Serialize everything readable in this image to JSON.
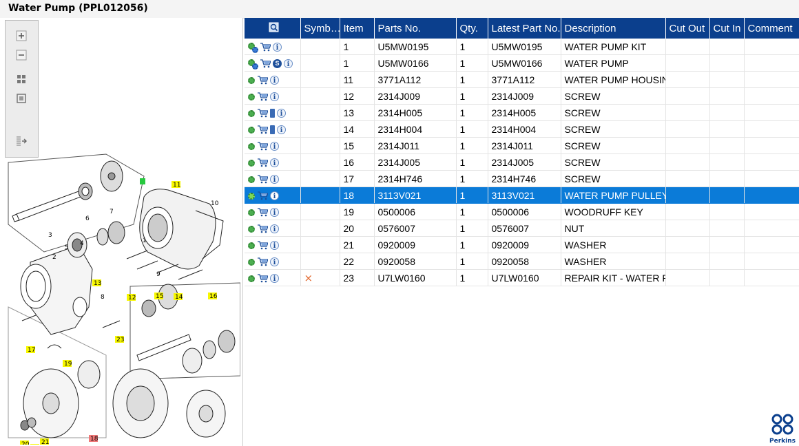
{
  "title": "Water Pump (PPL012056)",
  "toolbar": {
    "buttons": [
      {
        "name": "zoom-in-icon"
      },
      {
        "name": "zoom-out-icon"
      },
      {
        "name": "fit-grid-icon"
      },
      {
        "name": "fit-page-icon"
      },
      {
        "name": "export-icon"
      }
    ]
  },
  "diagram": {
    "labels": [
      "1",
      "2",
      "3",
      "4",
      "5",
      "6",
      "7",
      "8",
      "9",
      "10",
      "11",
      "12",
      "13",
      "14",
      "15",
      "16",
      "17",
      "18",
      "19",
      "20",
      "21",
      "22",
      "23"
    ],
    "highlight_colors": {
      "yellow": "#f7f700",
      "red": "#f07878",
      "green": "#27c93f"
    }
  },
  "table": {
    "columns": [
      "",
      "Symb…",
      "Item",
      "Parts No.",
      "Qty.",
      "Latest Part No.",
      "Description",
      "Cut Out",
      "Cut In",
      "Comment"
    ],
    "rows": [
      {
        "icons": [
          "multi-gear",
          "cart",
          "info"
        ],
        "symbol": "",
        "item": "1",
        "part": "U5MW0195",
        "qty": "1",
        "latest": "U5MW0195",
        "desc": "WATER PUMP KIT"
      },
      {
        "icons": [
          "multi-gear",
          "cart",
          "s",
          "info",
          "book-search"
        ],
        "symbol": "",
        "item": "1",
        "part": "U5MW0166",
        "qty": "1",
        "latest": "U5MW0166",
        "desc": "WATER PUMP"
      },
      {
        "icons": [
          "gear",
          "cart",
          "info"
        ],
        "symbol": "",
        "item": "11",
        "part": "3771A112",
        "qty": "1",
        "latest": "3771A112",
        "desc": "WATER PUMP HOUSIN"
      },
      {
        "icons": [
          "gear",
          "cart",
          "info"
        ],
        "symbol": "",
        "item": "12",
        "part": "2314J009",
        "qty": "1",
        "latest": "2314J009",
        "desc": "SCREW"
      },
      {
        "icons": [
          "gear",
          "cart",
          "book",
          "info"
        ],
        "symbol": "",
        "item": "13",
        "part": "2314H005",
        "qty": "1",
        "latest": "2314H005",
        "desc": "SCREW"
      },
      {
        "icons": [
          "gear",
          "cart",
          "book",
          "info"
        ],
        "symbol": "",
        "item": "14",
        "part": "2314H004",
        "qty": "1",
        "latest": "2314H004",
        "desc": "SCREW"
      },
      {
        "icons": [
          "gear",
          "cart",
          "info"
        ],
        "symbol": "",
        "item": "15",
        "part": "2314J011",
        "qty": "1",
        "latest": "2314J011",
        "desc": "SCREW"
      },
      {
        "icons": [
          "gear",
          "cart",
          "info"
        ],
        "symbol": "",
        "item": "16",
        "part": "2314J005",
        "qty": "1",
        "latest": "2314J005",
        "desc": "SCREW"
      },
      {
        "icons": [
          "gear",
          "cart",
          "info"
        ],
        "symbol": "",
        "item": "17",
        "part": "2314H746",
        "qty": "1",
        "latest": "2314H746",
        "desc": "SCREW"
      },
      {
        "icons": [
          "gear",
          "cart",
          "info"
        ],
        "symbol": "",
        "item": "18",
        "part": "3113V021",
        "qty": "1",
        "latest": "3113V021",
        "desc": "WATER PUMP PULLEY",
        "selected": true
      },
      {
        "icons": [
          "gear",
          "cart",
          "info"
        ],
        "symbol": "",
        "item": "19",
        "part": "0500006",
        "qty": "1",
        "latest": "0500006",
        "desc": "WOODRUFF KEY"
      },
      {
        "icons": [
          "gear",
          "cart",
          "info"
        ],
        "symbol": "",
        "item": "20",
        "part": "0576007",
        "qty": "1",
        "latest": "0576007",
        "desc": "NUT"
      },
      {
        "icons": [
          "gear",
          "cart",
          "info"
        ],
        "symbol": "",
        "item": "21",
        "part": "0920009",
        "qty": "1",
        "latest": "0920009",
        "desc": "WASHER"
      },
      {
        "icons": [
          "gear",
          "cart",
          "info"
        ],
        "symbol": "",
        "item": "22",
        "part": "0920058",
        "qty": "1",
        "latest": "0920058",
        "desc": "WASHER"
      },
      {
        "icons": [
          "gear",
          "cart",
          "info"
        ],
        "symbol": "×",
        "item": "23",
        "part": "U7LW0160",
        "qty": "1",
        "latest": "U7LW0160",
        "desc": "REPAIR KIT - WATER P"
      }
    ]
  },
  "logo": {
    "text": "Perkins",
    "color": "#0b3f8d"
  },
  "colors": {
    "header": "#0b3f8d",
    "selected_row": "#0b7bd8",
    "symbol_x": "#e2662c"
  }
}
